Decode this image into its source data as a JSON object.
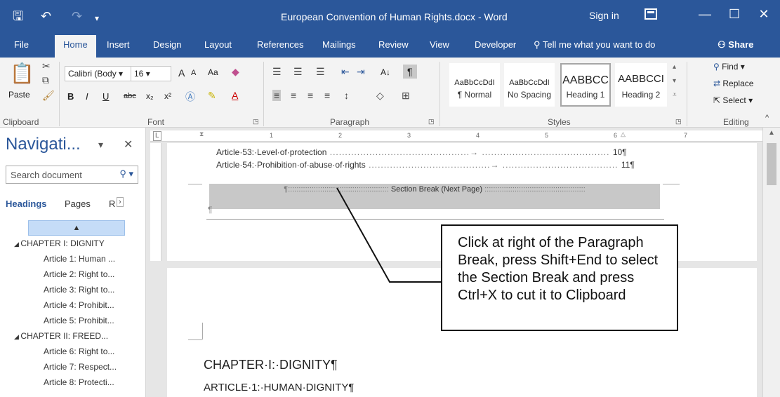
{
  "titlebar": {
    "save_icon": "save-icon",
    "undo_icon": "undo-icon",
    "redo_icon": "redo-icon",
    "title": "European Convention of Human Rights.docx - Word",
    "sign_in": "Sign in",
    "minimize": "—",
    "maximize": "☐",
    "close": "✕"
  },
  "tabs": [
    "File",
    "Home",
    "Insert",
    "Design",
    "Layout",
    "References",
    "Mailings",
    "Review",
    "View",
    "Developer"
  ],
  "tell_me": "Tell me what you want to do",
  "share": "Share",
  "ribbon": {
    "clipboard": {
      "paste": "Paste",
      "label": "Clipboard"
    },
    "font": {
      "name": "Calibri (Body",
      "size": "16",
      "grow": "A",
      "shrink": "A",
      "case": "Aa",
      "bold": "B",
      "italic": "I",
      "underline": "U",
      "strike": "abc",
      "subscript": "x₂",
      "superscript": "x²",
      "label": "Font"
    },
    "paragraph": {
      "sort": "A↓",
      "pilcrow": "¶",
      "label": "Paragraph"
    },
    "styles": {
      "items": [
        {
          "preview": "AaBbCcDdI",
          "name": "¶ Normal"
        },
        {
          "preview": "AaBbCcDdI",
          "name": "No Spacing"
        },
        {
          "preview": "AABBCC",
          "name": "Heading 1"
        },
        {
          "preview": "AABBCCI",
          "name": "Heading 2"
        }
      ],
      "label": "Styles"
    },
    "editing": {
      "find": "Find",
      "replace": "Replace",
      "select": "Select",
      "label": "Editing"
    }
  },
  "nav": {
    "title": "Navigati...",
    "search_placeholder": "Search document",
    "tabs": [
      "Headings",
      "Pages",
      "R"
    ],
    "collapse": "▲",
    "items": [
      {
        "level": 1,
        "text": "CHAPTER I: DIGNITY"
      },
      {
        "level": 2,
        "text": "Article 1: Human ..."
      },
      {
        "level": 2,
        "text": "Article 2: Right to..."
      },
      {
        "level": 2,
        "text": "Article 3: Right to..."
      },
      {
        "level": 2,
        "text": "Article 4: Prohibit..."
      },
      {
        "level": 2,
        "text": "Article 5: Prohibit..."
      },
      {
        "level": 1,
        "text": "CHAPTER II: FREED..."
      },
      {
        "level": 2,
        "text": "Article 6: Right to..."
      },
      {
        "level": 2,
        "text": "Article 7: Respect..."
      },
      {
        "level": 2,
        "text": "Article 8: Protecti..."
      }
    ]
  },
  "ruler": {
    "marks": [
      "1",
      "2",
      "3",
      "4",
      "5",
      "6",
      "7"
    ]
  },
  "document": {
    "toc": [
      {
        "text": "Article·53:·Level·of·protection",
        "page": "10¶"
      },
      {
        "text": "Article·54:·Prohibition·of·abuse·of·rights",
        "page": "11¶"
      }
    ],
    "section_break": "Section Break (Next Page)",
    "pilcrow": "¶",
    "chapter_heading": "CHAPTER·I:·DIGNITY¶",
    "article_heading": "ARTICLE·1:·HUMAN·DIGNITY¶"
  },
  "callout": {
    "text": "Click at right of the Paragraph Break, press Shift+End to select the Section Break and press Ctrl+X to cut it to Clipboard"
  }
}
